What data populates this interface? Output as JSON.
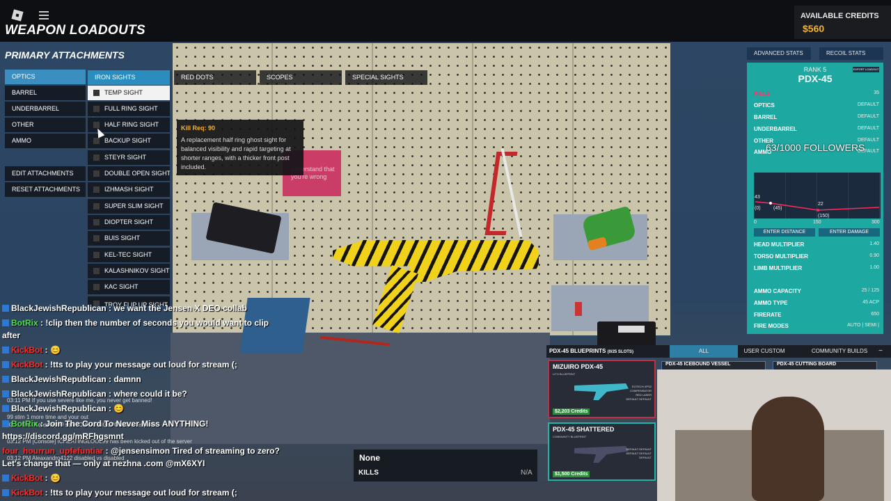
{
  "header": {
    "title": "WEAPON LOADOUTS",
    "credits_label": "AVAILABLE CREDITS",
    "credits_value": "$560"
  },
  "left_panel": {
    "title": "PRIMARY ATTACHMENTS",
    "categories": [
      "OPTICS",
      "BARREL",
      "UNDERBARREL",
      "OTHER",
      "AMMO"
    ],
    "actions": [
      "EDIT ATTACHMENTS",
      "RESET ATTACHMENTS"
    ],
    "tabs": [
      "IRON SIGHTS",
      "RED DOTS",
      "SCOPES",
      "SPECIAL SIGHTS"
    ],
    "attachments": [
      "TEMP SIGHT",
      "FULL RING SIGHT",
      "HALF RING SIGHT",
      "BACKUP SIGHT",
      "STEYR SIGHT",
      "DOUBLE OPEN SIGHT",
      "IZHMASH SIGHT",
      "SUPER SLIM SIGHT",
      "DIOPTER SIGHT",
      "BUIS SIGHT",
      "KEL-TEC SIGHT",
      "KALASHNIKOV SIGHT",
      "KAC SIGHT",
      "TROY FLIP UP SIGHT"
    ]
  },
  "tooltip": {
    "requirement": "Kill Req: 90",
    "description": "A replacement half ring ghost sight for balanced visibility and rapid targeting at shorter ranges, with a thicker front post included."
  },
  "poster_text": "understand that you're wrong",
  "stats": {
    "tabs": [
      "ADVANCED STATS",
      "RECOIL STATS"
    ],
    "rank": "RANK 5",
    "weapon": "PDX-45",
    "export_label": "EXPORT LOADOUT",
    "kills_label": "KILLS",
    "kills_value": "35",
    "rows": [
      {
        "label": "OPTICS",
        "value": "DEFAULT"
      },
      {
        "label": "BARREL",
        "value": "DEFAULT"
      },
      {
        "label": "UNDERBARREL",
        "value": "DEFAULT"
      },
      {
        "label": "OTHER",
        "value": "DEFAULT"
      },
      {
        "label": "AMMO",
        "value": "DEFAULT"
      }
    ],
    "followers": "63/1000 FOLLOWERS",
    "graph": {
      "max_dmg": "43",
      "max_dmg_range": "(0)",
      "mid_label": "(45)",
      "min_dmg": "22",
      "min_dmg_range": "(150)",
      "ticks": [
        "0",
        "150",
        "300"
      ]
    },
    "enter_distance": "ENTER DISTANCE",
    "enter_damage": "ENTER DAMAGE",
    "multipliers": [
      {
        "label": "HEAD MULTIPLIER",
        "value": "1.40"
      },
      {
        "label": "TORSO MULTIPLIER",
        "value": "0.90"
      },
      {
        "label": "LIMB MULTIPLIER",
        "value": "1.00"
      }
    ],
    "ammo": [
      {
        "label": "AMMO CAPACITY",
        "value": "25 / 125"
      },
      {
        "label": "AMMO TYPE",
        "value": "45 ACP"
      },
      {
        "label": "FIRERATE",
        "value": "650"
      }
    ],
    "fire_modes_label": "FIRE MODES",
    "fire_modes_value": "AUTO | SEMI |"
  },
  "blueprints": {
    "title": "PDX-45 BLUEPRINTS",
    "slots": "(0/25 SLOTS)",
    "tabs": [
      "ALL",
      "USER CUSTOM",
      "COMMUNITY BUILDS"
    ],
    "minimize": "−",
    "cards": [
      {
        "name": "MIZUIRO PDX-45",
        "sub": "LITO BLUEPRINT",
        "credits": "$2,203 Credits",
        "side": "EOTECH XPS2 COMPENSATOR RED LASER DEFAULT DEFAULT"
      },
      {
        "name": "PDX-45 SHATTERED",
        "sub": "COMMUNITY BLUEPRINT",
        "credits": "$1,500 Credits",
        "side": "DEFAULT DEFAULT DEFAULT DEFAULT DEFAULT"
      }
    ],
    "more": [
      "PDX-45 ICEBOUND VESSEL",
      "PDX-45 CUTTING BOARD"
    ]
  },
  "chat": [
    {
      "name": "BlackJewishRepublican",
      "color": "white",
      "msg": " : we want the Jensen X DEO collab"
    },
    {
      "name": "BotRix",
      "color": "green",
      "msg": " : !clip then the number of seconds you would want to clip"
    },
    {
      "name": "",
      "color": "white",
      "msg": "after"
    },
    {
      "name": "KickBot",
      "color": "red",
      "msg": " : 😊"
    },
    {
      "name": "KickBot",
      "color": "red",
      "msg": " : !tts to play your message out loud for stream (;"
    },
    {
      "name": "BlackJewishRepublican",
      "color": "white",
      "msg": " : damnn"
    },
    {
      "name": "BlackJewishRepublican",
      "color": "white",
      "msg": " : where could it be?"
    },
    {
      "name": "BlackJewishRepublican",
      "color": "white",
      "msg": " : 😊"
    },
    {
      "name": "BotRix",
      "color": "green",
      "msg": " : Join The Cord To Never Miss ANYTHING!"
    },
    {
      "name": "",
      "color": "white",
      "msg": "https://discord.gg/mRFhgsmnt"
    },
    {
      "name": "four_hourrun_upfefuntiar",
      "color": "red",
      "msg": " : @jensensimon Tired of streaming to zero?"
    },
    {
      "name": "",
      "color": "white",
      "msg": "Let's change that — only at nezhna .com @mX6XYI"
    },
    {
      "name": "KickBot",
      "color": "red",
      "msg": " : 😊"
    },
    {
      "name": "KickBot",
      "color": "red",
      "msg": " : !tts to play your message out loud for stream (;"
    }
  ],
  "console": [
    "03:11 PM  If you use severe like me, you never get banned!",
    "99 stim 1 more time and your out",
    "03:11 PM  (Console) 99 stim ICHEATINGLOOL99 for exploits",
    "03:12 PM  [Console] ICHEATINGLOOL99 has been kicked out of the server",
    "03:12 PM  Aleaxandro4122 disabled vs disabled"
  ],
  "mini_box": {
    "title": "None",
    "kills": "KILLS",
    "value": "N/A"
  }
}
